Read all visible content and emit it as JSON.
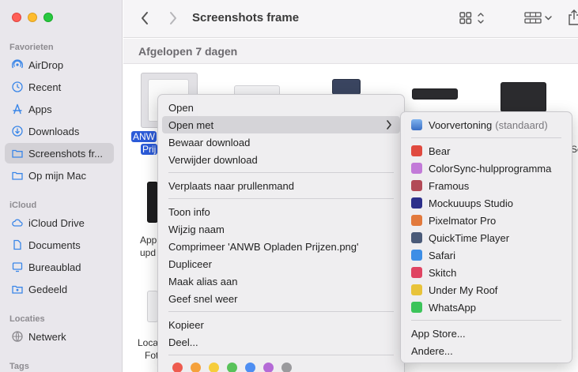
{
  "window": {
    "title": "Screenshots frame"
  },
  "sidebar": {
    "sections": [
      {
        "label": "Favorieten",
        "items": [
          {
            "label": "AirDrop",
            "icon": "airdrop-icon"
          },
          {
            "label": "Recent",
            "icon": "clock-icon"
          },
          {
            "label": "Apps",
            "icon": "apps-icon"
          },
          {
            "label": "Downloads",
            "icon": "download-icon"
          },
          {
            "label": "Screenshots fr...",
            "icon": "folder-icon",
            "active": true
          },
          {
            "label": "Op mijn Mac",
            "icon": "folder-icon"
          }
        ]
      },
      {
        "label": "iCloud",
        "items": [
          {
            "label": "iCloud Drive",
            "icon": "cloud-icon"
          },
          {
            "label": "Documents",
            "icon": "document-icon"
          },
          {
            "label": "Bureaublad",
            "icon": "desktop-icon"
          },
          {
            "label": "Gedeeld",
            "icon": "shared-folder-icon"
          }
        ]
      },
      {
        "label": "Locaties",
        "items": [
          {
            "label": "Netwerk",
            "icon": "network-icon"
          }
        ]
      },
      {
        "label": "Tags",
        "items": []
      }
    ]
  },
  "content": {
    "section_title": "Afgelopen 7 dagen",
    "files": [
      {
        "label_line1": "ANW",
        "label_line2": "Prij"
      },
      {
        "label_line1": "App",
        "label_line2": "upd"
      },
      {
        "label_line1": "Loca",
        "label_line2": "Fot"
      },
      {
        "label_right": "Sc"
      }
    ]
  },
  "context_menu": {
    "items": [
      "Open",
      "Open met",
      "Bewaar download",
      "Verwijder download",
      "Verplaats naar prullenmand",
      "Toon info",
      "Wijzig naam",
      "Comprimeer 'ANWB Opladen Prijzen.png'",
      "Dupliceer",
      "Maak alias aan",
      "Geef snel weer",
      "Kopieer",
      "Deel..."
    ],
    "tag_colors": [
      "#ee5b4f",
      "#f5a13c",
      "#f6cd3b",
      "#59c25a",
      "#4e8ef2",
      "#b46ad6",
      "#9a9a9d"
    ]
  },
  "submenu": {
    "default_app": "Voorvertoning",
    "default_suffix": "(standaard)",
    "apps": [
      {
        "label": "Bear",
        "color": "#e04a3f"
      },
      {
        "label": "ColorSync-hulpprogramma",
        "color": "#c27ad8"
      },
      {
        "label": "Framous",
        "color": "#b24a57"
      },
      {
        "label": "Mockuuups Studio",
        "color": "#2c2f8a"
      },
      {
        "label": "Pixelmator Pro",
        "color": "#e2793c"
      },
      {
        "label": "QuickTime Player",
        "color": "#4a5a78"
      },
      {
        "label": "Safari",
        "color": "#3d8ee6"
      },
      {
        "label": "Skitch",
        "color": "#e04462"
      },
      {
        "label": "Under My Roof",
        "color": "#e8c33a"
      },
      {
        "label": "WhatsApp",
        "color": "#3cc45a"
      }
    ],
    "app_store": "App Store...",
    "other": "Andere..."
  }
}
